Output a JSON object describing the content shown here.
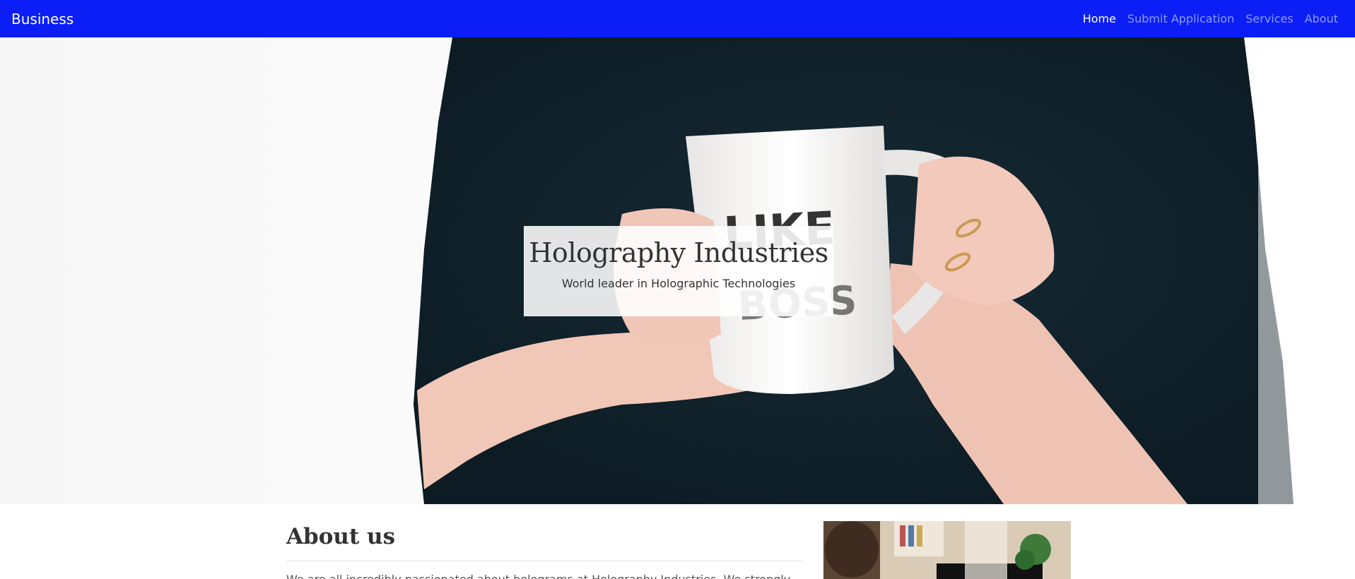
{
  "navbar": {
    "brand": "Business",
    "items": [
      {
        "label": "Home",
        "active": true
      },
      {
        "label": "Submit Application",
        "active": false
      },
      {
        "label": "Services",
        "active": false
      },
      {
        "label": "About",
        "active": false
      }
    ],
    "bg_color": "#0a1ef5"
  },
  "hero": {
    "title": "Holography Industries",
    "subtitle": "World leader in Holographic Technologies",
    "mug_text": "LIKE A BOSS",
    "image_icon": "woman-holding-mug-photo"
  },
  "about": {
    "heading": "About us",
    "text": "We are all incredibly passionated about holograms at Holography Industries. We strongly",
    "image_icon": "office-photo"
  }
}
